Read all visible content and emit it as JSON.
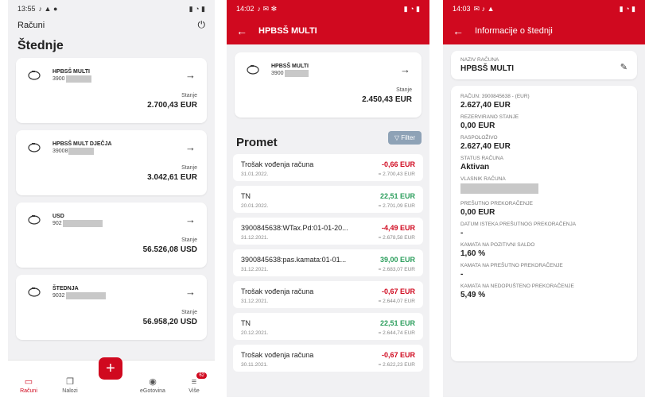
{
  "screen1": {
    "status_time": "13:55",
    "title": "Računi",
    "section": "Štednje",
    "accounts": [
      {
        "name": "HPBSŠ MULTI",
        "num_prefix": "3900",
        "bal_label": "Stanje",
        "balance": "2.700,43 EUR"
      },
      {
        "name": "HPBSŠ MULT DJEČJA",
        "num_prefix": "39008",
        "bal_label": "Stanje",
        "balance": "3.042,61 EUR"
      },
      {
        "name": "USD",
        "num_prefix": "902",
        "bal_label": "Stanje",
        "balance": "56.526,08 USD"
      },
      {
        "name": "ŠTEDNJA",
        "num_prefix": "9032",
        "bal_label": "Stanje",
        "balance": "56.958,20 USD"
      }
    ],
    "nav": [
      {
        "label": "Računi"
      },
      {
        "label": "Nalozi"
      },
      {
        "label": "eGotovina"
      },
      {
        "label": "Više",
        "badge": "62"
      }
    ]
  },
  "screen2": {
    "status_time": "14:02",
    "title": "HPBSŠ MULTI",
    "account": {
      "name": "HPBSŠ MULTI",
      "num_prefix": "3900",
      "bal_label": "Stanje",
      "balance": "2.450,43 EUR"
    },
    "section": "Promet",
    "filter": "Filter",
    "transactions": [
      {
        "desc": "Trošak vođenja računa",
        "date": "31.01.2022.",
        "amount": "-0,66 EUR",
        "type": "neg",
        "balance": "= 2.700,43 EUR"
      },
      {
        "desc": "TN",
        "date": "20.01.2022.",
        "amount": "22,51 EUR",
        "type": "pos",
        "balance": "= 2.701,09 EUR"
      },
      {
        "desc": "3900845638:WTax.Pd:01-01-20...",
        "date": "31.12.2021.",
        "amount": "-4,49 EUR",
        "type": "neg",
        "balance": "= 2.678,58 EUR"
      },
      {
        "desc": "3900845638:pas.kamata:01-01...",
        "date": "31.12.2021.",
        "amount": "39,00 EUR",
        "type": "pos",
        "balance": "= 2.683,07 EUR"
      },
      {
        "desc": "Trošak vođenja računa",
        "date": "31.12.2021.",
        "amount": "-0,67 EUR",
        "type": "neg",
        "balance": "= 2.644,07 EUR"
      },
      {
        "desc": "TN",
        "date": "20.12.2021.",
        "amount": "22,51 EUR",
        "type": "pos",
        "balance": "= 2.644,74 EUR"
      },
      {
        "desc": "Trošak vođenja računa",
        "date": "30.11.2021.",
        "amount": "-0,67 EUR",
        "type": "neg",
        "balance": "= 2.622,23 EUR"
      }
    ]
  },
  "screen3": {
    "status_time": "14:03",
    "title": "Informacije o štednji",
    "name_label": "NAZIV RAČUNA",
    "name_value": "HPBSŠ MULTI",
    "fields": [
      {
        "label": "RAČUN: 3900845638 - (EUR)",
        "value": "2.627,40 EUR"
      },
      {
        "label": "REZERVIRANO STANJE",
        "value": "0,00 EUR"
      },
      {
        "label": "RASPOLOŽIVO",
        "value": "2.627,40 EUR"
      },
      {
        "label": "STATUS RAČUNA",
        "value": "Aktivan"
      },
      {
        "label": "VLASNIK RAČUNA",
        "value": ""
      },
      {
        "label": "PREŠUTNO PREKORAČENJE",
        "value": "0,00 EUR"
      },
      {
        "label": "DATUM ISTEKA PREŠUTNOG PREKORAČENJA",
        "value": "-"
      },
      {
        "label": "KAMATA NA POZITIVNI SALDO",
        "value": "1,60 %"
      },
      {
        "label": "KAMATA NA PREŠUTNO PREKORAČENJE",
        "value": "-"
      },
      {
        "label": "KAMATA NA NEDOPUŠTENO PREKORAČENJE",
        "value": "5,49 %"
      }
    ]
  }
}
